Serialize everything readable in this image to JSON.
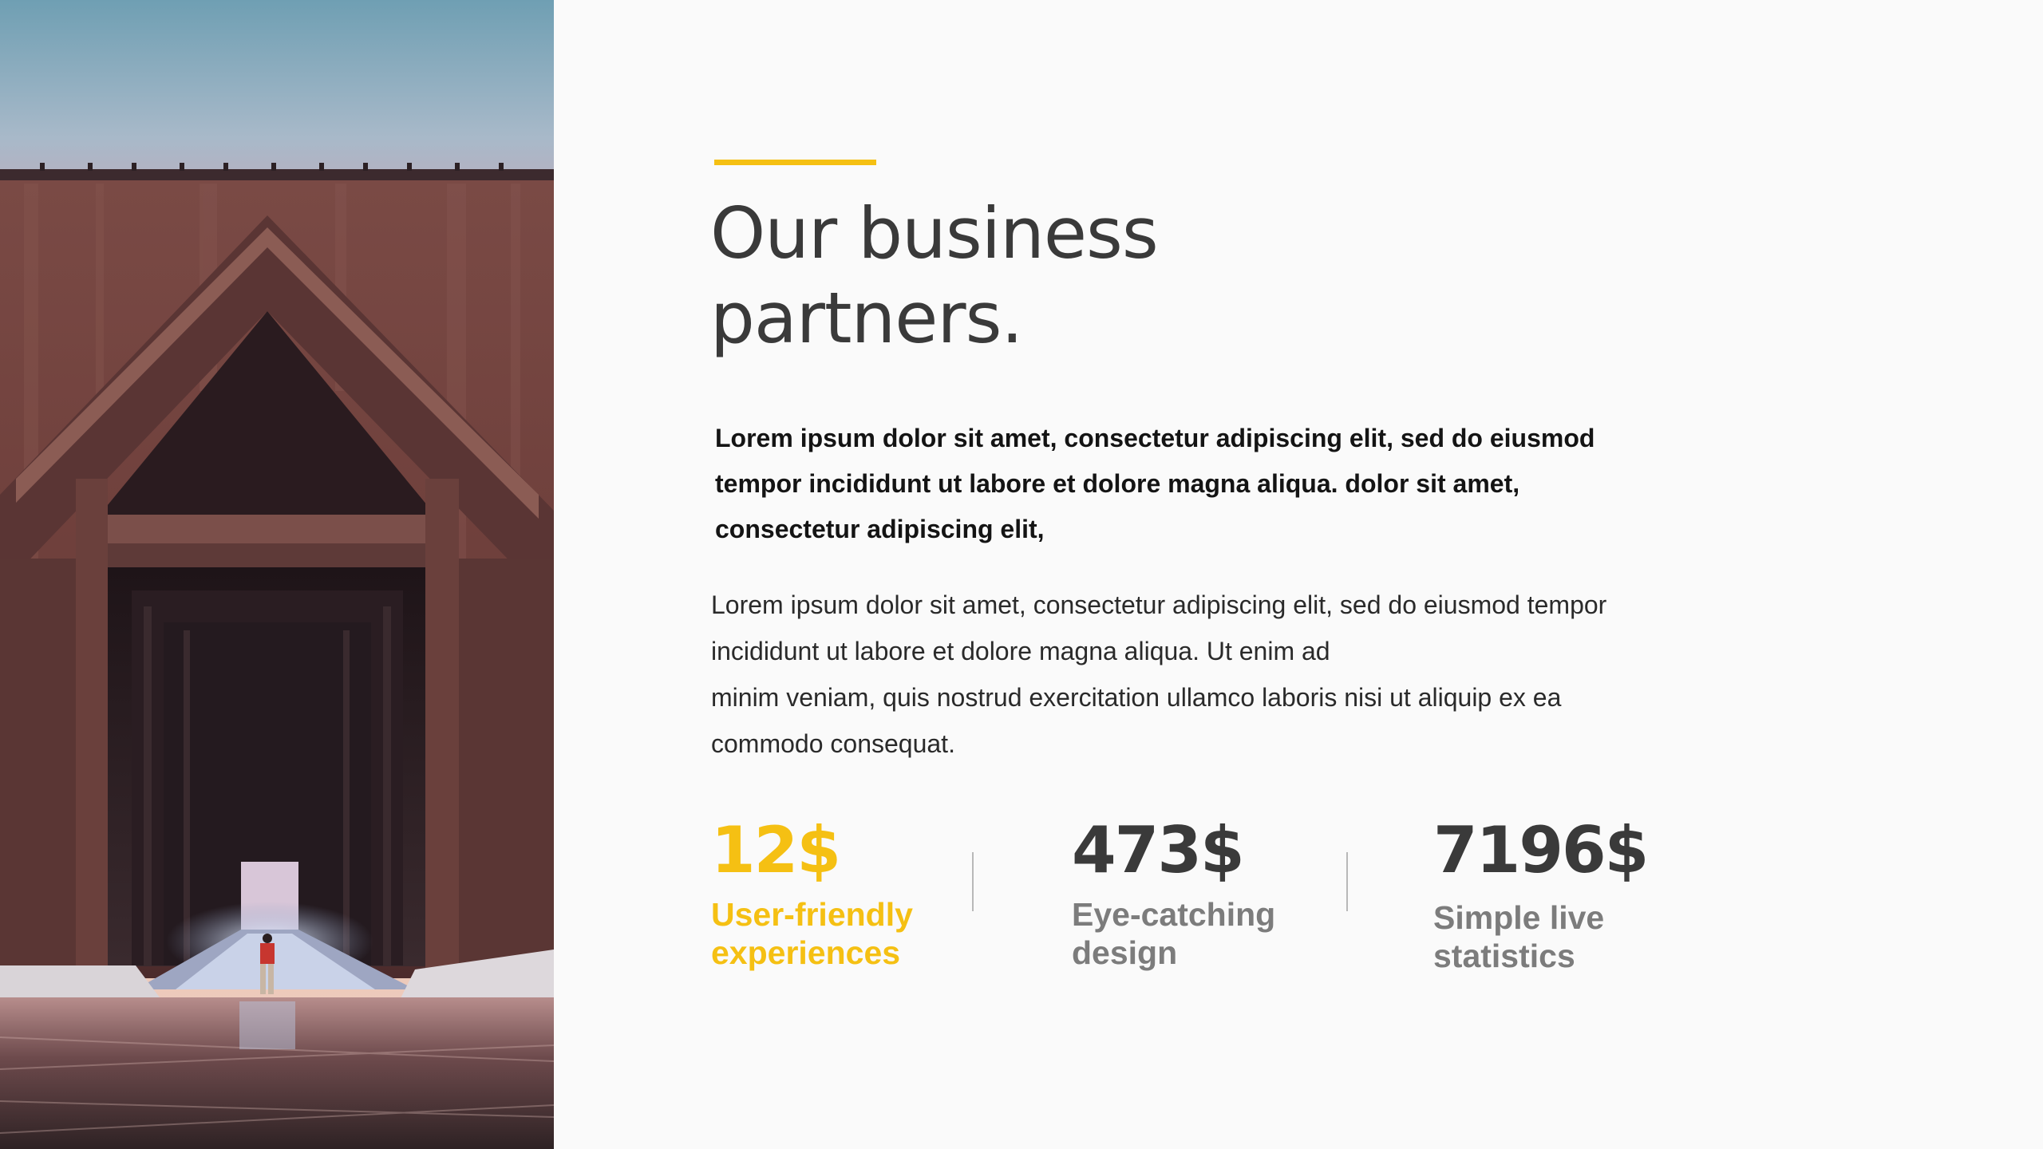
{
  "slide": {
    "title": "Our business\npartners.",
    "lead": "Lorem ipsum dolor sit amet, consectetur adipiscing elit, sed do eiusmod tempor incididunt ut labore et dolore magna aliqua. dolor sit amet, consectetur adipiscing elit,",
    "body_lines": [
      "Lorem ipsum dolor sit amet, consectetur adipiscing elit, sed do eiusmod tempor",
      "incididunt ut labore et dolore magna aliqua. Ut enim ad",
      "minim veniam, quis nostrud exercitation ullamco laboris nisi ut aliquip ex ea",
      "commodo consequat."
    ],
    "stats": [
      {
        "value": "12$",
        "label": "User-friendly\nexperiences"
      },
      {
        "value": "473$",
        "label": "Eye-catching\ndesign"
      },
      {
        "value": "7196$",
        "label": "Simple  live\nstatistics"
      }
    ]
  },
  "colors": {
    "accent": "#f5c013",
    "heading": "#3a3a3a",
    "muted": "#7c7c7c",
    "background": "#fafafa"
  }
}
